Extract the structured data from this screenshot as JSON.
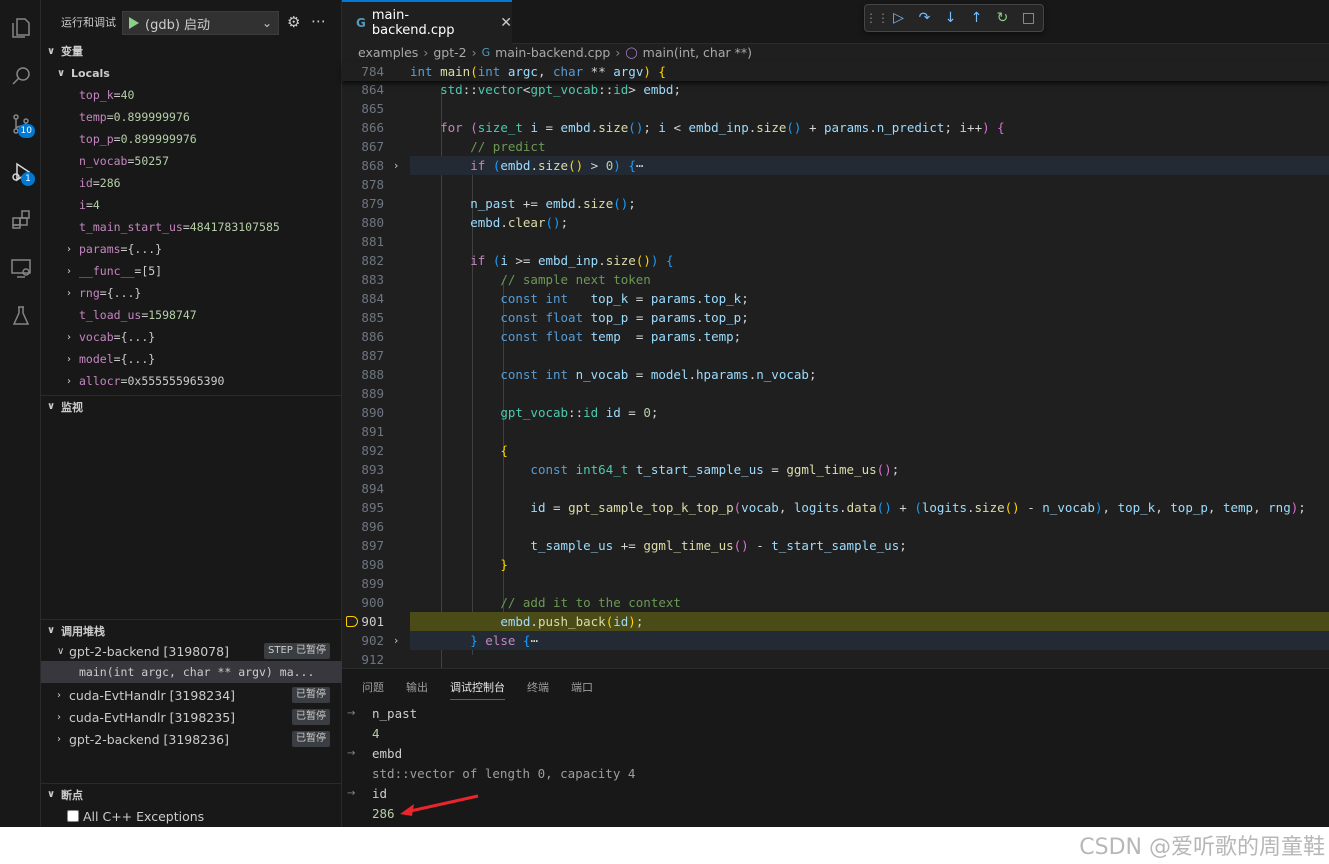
{
  "activity_bar": {
    "items": [
      {
        "icon": "explorer-icon",
        "badge": ""
      },
      {
        "icon": "search-icon",
        "badge": ""
      },
      {
        "icon": "source-control-icon",
        "badge": "10"
      },
      {
        "icon": "run-debug-icon",
        "badge": "1"
      },
      {
        "icon": "extensions-icon",
        "badge": ""
      },
      {
        "icon": "remote-explorer-icon",
        "badge": ""
      },
      {
        "icon": "testing-icon",
        "badge": ""
      }
    ]
  },
  "sidebar": {
    "header_title": "运行和调试",
    "launch_config": "(gdb) 启动",
    "variables_title": "变量",
    "locals_title": "Locals",
    "locals": [
      {
        "name": "top_k",
        "value": "40",
        "expandable": false
      },
      {
        "name": "temp",
        "value": "0.899999976",
        "expandable": false
      },
      {
        "name": "top_p",
        "value": "0.899999976",
        "expandable": false
      },
      {
        "name": "n_vocab",
        "value": "50257",
        "expandable": false
      },
      {
        "name": "id",
        "value": "286",
        "expandable": false
      },
      {
        "name": "i",
        "value": "4",
        "expandable": false
      },
      {
        "name": "t_main_start_us",
        "value": "4841783107585",
        "expandable": false
      },
      {
        "name": "params",
        "value": "{...}",
        "expandable": true
      },
      {
        "name": "__func__",
        "value": "[5]",
        "expandable": true
      },
      {
        "name": "rng",
        "value": "{...}",
        "expandable": true
      },
      {
        "name": "t_load_us",
        "value": "1598747",
        "expandable": false
      },
      {
        "name": "vocab",
        "value": "{...}",
        "expandable": true
      },
      {
        "name": "model",
        "value": "{...}",
        "expandable": true
      },
      {
        "name": "allocr",
        "value": "0x555555965390",
        "expandable": true
      }
    ],
    "watch_title": "监视",
    "callstack_title": "调用堆栈",
    "threads": [
      {
        "label": "gpt-2-backend [3198078]",
        "status": "已暂停",
        "step": "STEP",
        "expanded": true
      },
      {
        "label": "cuda-EvtHandlr [3198234]",
        "status": "已暂停",
        "step": "",
        "expanded": false
      },
      {
        "label": "cuda-EvtHandlr [3198235]",
        "status": "已暂停",
        "step": "",
        "expanded": false
      },
      {
        "label": "gpt-2-backend [3198236]",
        "status": "已暂停",
        "step": "",
        "expanded": false
      }
    ],
    "current_frame": "main(int argc, char ** argv)  ma...",
    "breakpoints_title": "断点",
    "breakpoint_items": [
      {
        "label": "All C++ Exceptions",
        "checked": false
      }
    ]
  },
  "editor": {
    "tab_label": "main-backend.cpp",
    "tab_icon": "G",
    "breadcrumb": [
      "examples",
      "gpt-2",
      "main-backend.cpp",
      "main(int, char **)"
    ],
    "current_line": "901"
  },
  "panel": {
    "tabs": [
      "问题",
      "输出",
      "调试控制台",
      "终端",
      "端口"
    ],
    "active_tab": "调试控制台",
    "console": [
      {
        "kind": "input",
        "text": "n_past"
      },
      {
        "kind": "output",
        "text": "4"
      },
      {
        "kind": "input",
        "text": "embd"
      },
      {
        "kind": "output",
        "text": "std::vector of length 0, capacity 4"
      },
      {
        "kind": "input",
        "text": "id"
      },
      {
        "kind": "output",
        "text": "286"
      }
    ]
  },
  "footer": {
    "watermark": "CSDN @爱听歌的周童鞋"
  },
  "colors": {
    "accent": "#0078d4",
    "current_line_bg": "#4b4b18",
    "annotation_arrow": "#e8262b"
  }
}
